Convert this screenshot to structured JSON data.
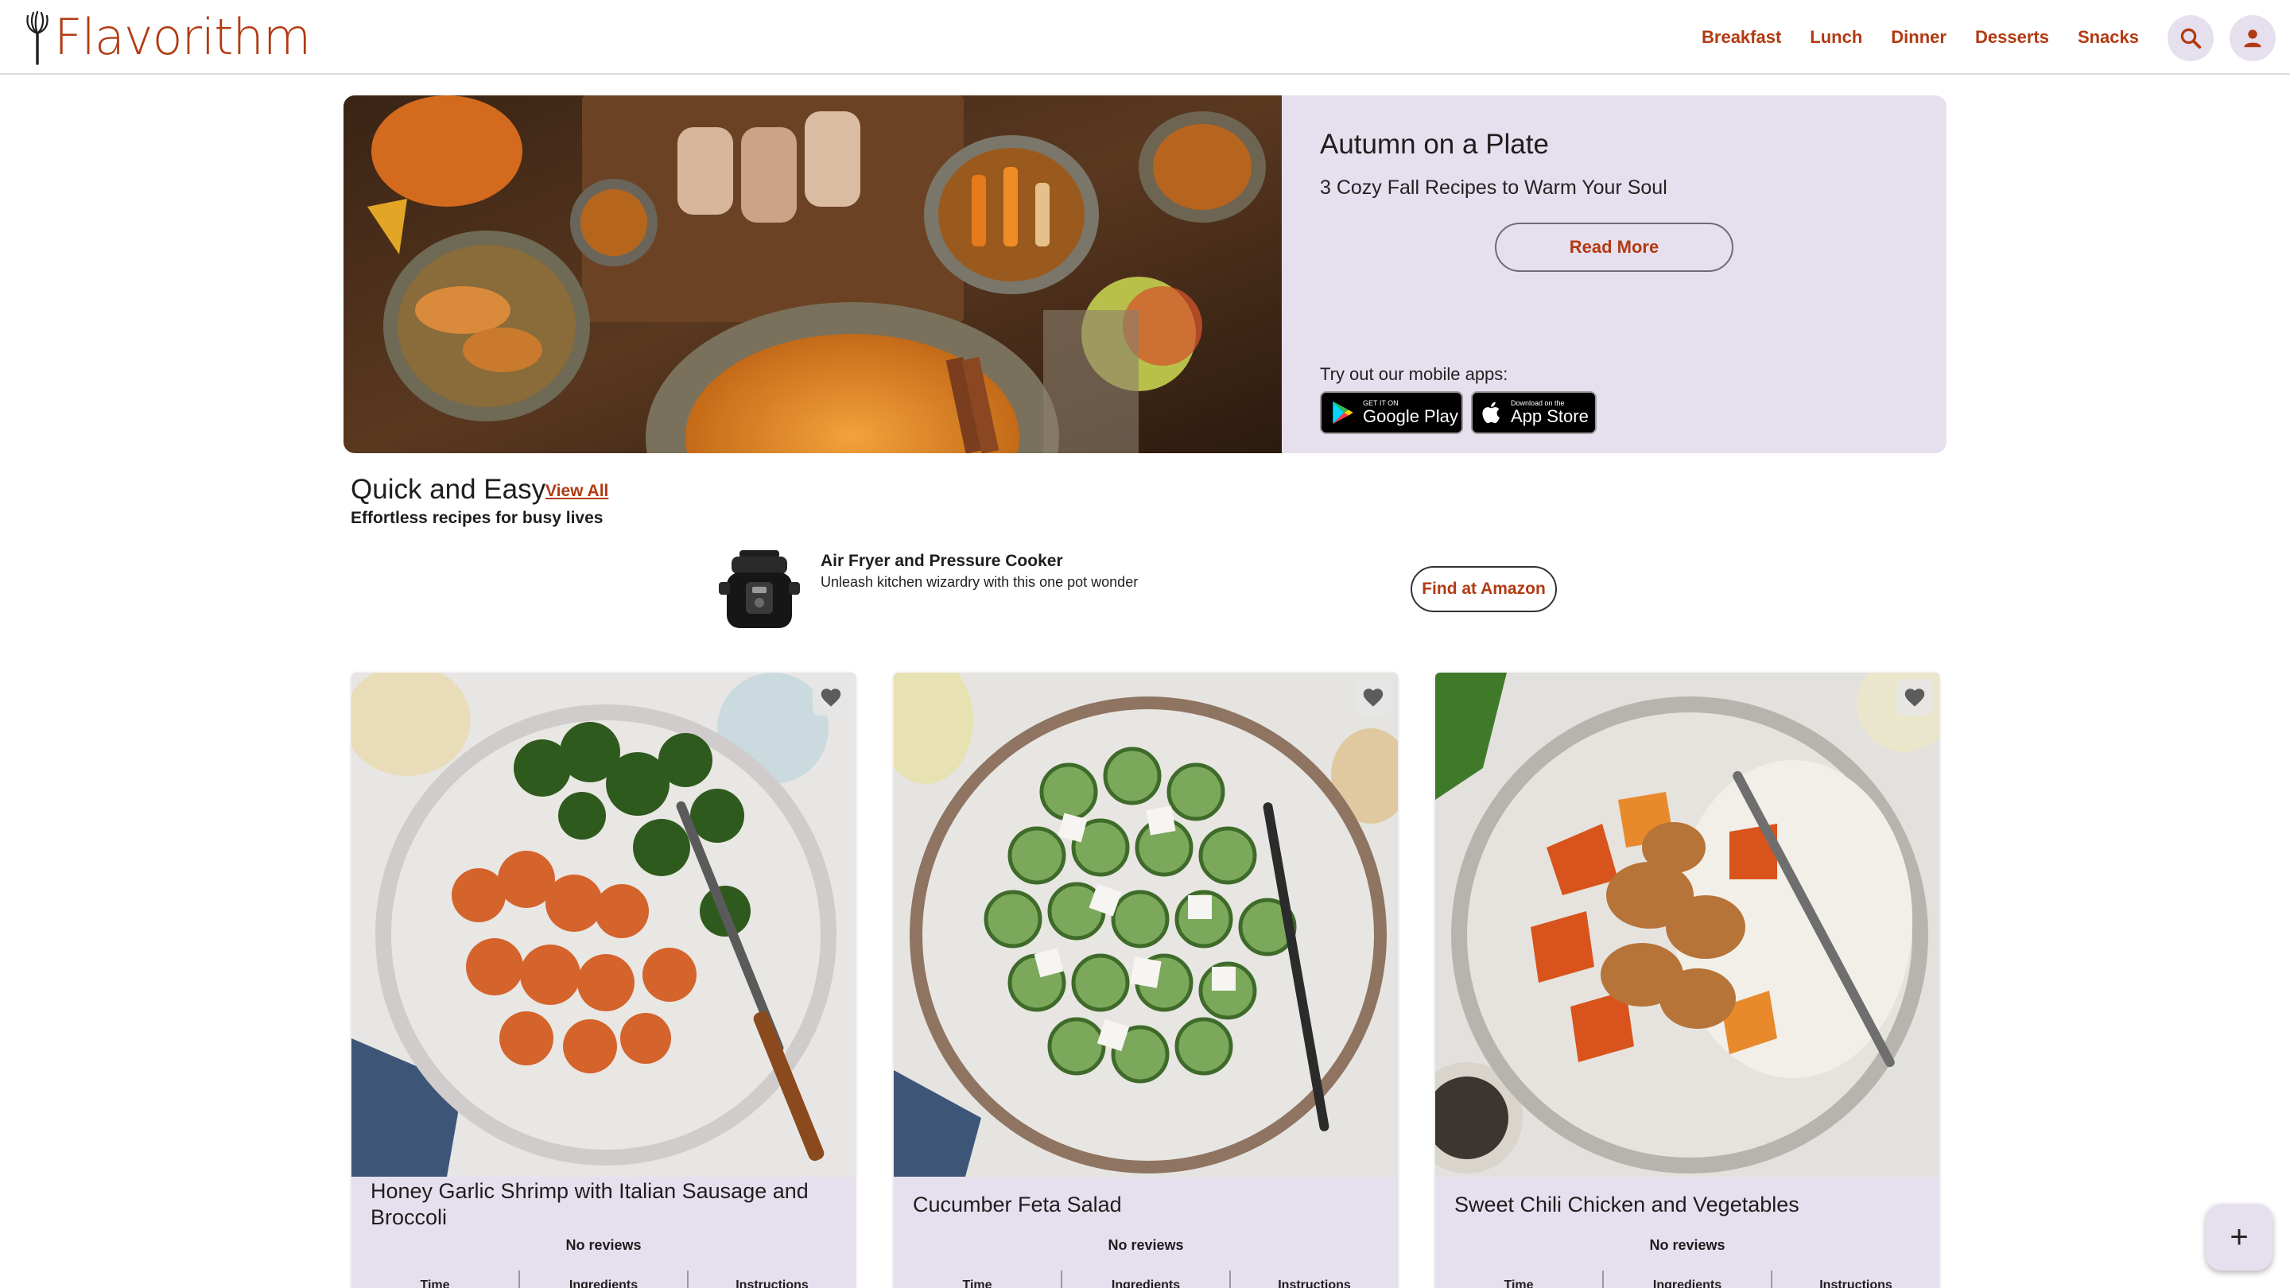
{
  "brand": {
    "name": "Flavorithm",
    "accent": "#b23a12",
    "surface": "#e6e0ee"
  },
  "nav": {
    "items": [
      "Breakfast",
      "Lunch",
      "Dinner",
      "Desserts",
      "Snacks"
    ],
    "search_icon": "search-icon",
    "account_icon": "user-icon"
  },
  "hero": {
    "title": "Autumn on a Plate",
    "subtitle": "3 Cozy Fall Recipes to Warm Your Soul",
    "cta": "Read More",
    "apps_label": "Try out our mobile apps:",
    "google_small": "GET IT ON",
    "google_big": "Google Play",
    "apple_small": "Download on the",
    "apple_big": "App Store"
  },
  "section": {
    "title": "Quick and Easy",
    "view_all": "View All",
    "subtitle": "Effortless recipes for busy lives"
  },
  "ad": {
    "title": "Air Fryer and Pressure Cooker",
    "desc": "Unleash kitchen wizardry with this one pot wonder",
    "cta": "Find at Amazon"
  },
  "cards": [
    {
      "title": "Honey Garlic Shrimp with Italian Sausage and Broccoli",
      "reviews": "No reviews",
      "stats": [
        "Time",
        "Ingredients",
        "Instructions"
      ]
    },
    {
      "title": "Cucumber Feta Salad",
      "reviews": "No reviews",
      "stats": [
        "Time",
        "Ingredients",
        "Instructions"
      ]
    },
    {
      "title": "Sweet Chili Chicken and Vegetables",
      "reviews": "No reviews",
      "stats": [
        "Time",
        "Ingredients",
        "Instructions"
      ]
    }
  ],
  "fab": {
    "label": "+"
  }
}
